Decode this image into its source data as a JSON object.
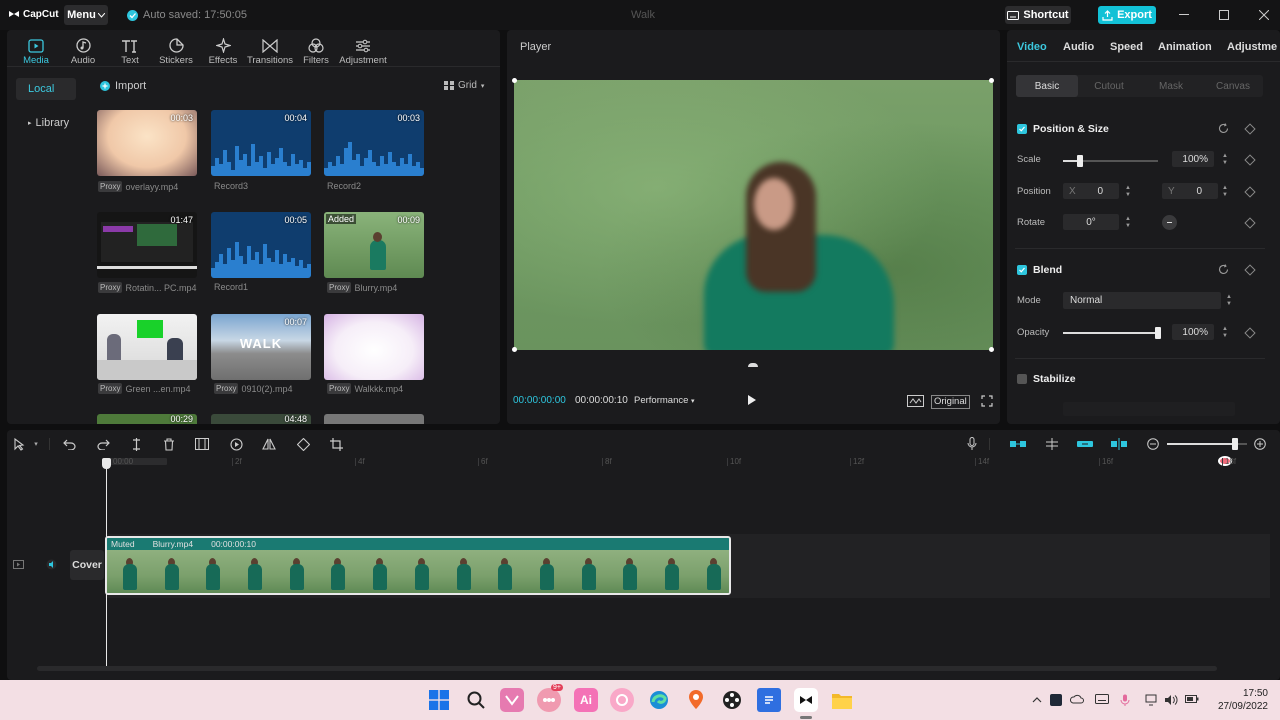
{
  "titlebar": {
    "logo": "CapCut",
    "menu": "Menu",
    "autosave": "Auto saved: 17:50:05",
    "title": "Walk",
    "shortcut": "Shortcut",
    "export": "Export"
  },
  "media_toolbar": [
    {
      "label": "Media",
      "icon": "media-icon",
      "active": true
    },
    {
      "label": "Audio",
      "icon": "audio-icon"
    },
    {
      "label": "Text",
      "icon": "text-icon"
    },
    {
      "label": "Stickers",
      "icon": "sticker-icon"
    },
    {
      "label": "Effects",
      "icon": "effects-icon"
    },
    {
      "label": "Transitions",
      "icon": "transitions-icon"
    },
    {
      "label": "Filters",
      "icon": "filters-icon"
    },
    {
      "label": "Adjustment",
      "icon": "adjustment-icon"
    }
  ],
  "media_side": {
    "local": "Local",
    "library": "Library"
  },
  "media_actions": {
    "import": "Import",
    "view": "Grid"
  },
  "media_items": [
    {
      "name": "overlayy.mp4",
      "duration": "00:03",
      "proxy": "Proxy"
    },
    {
      "name": "Record3",
      "duration": "00:04"
    },
    {
      "name": "Record2",
      "duration": "00:03"
    },
    {
      "name": "Rotatin... PC.mp4",
      "duration": "01:47",
      "proxy": "Proxy"
    },
    {
      "name": "Record1",
      "duration": "00:05"
    },
    {
      "name": "Blurry.mp4",
      "duration": "00:09",
      "proxy": "Proxy",
      "badge": "Added"
    },
    {
      "name": "Green ...en.mp4",
      "duration": "",
      "proxy": "Proxy"
    },
    {
      "name": "0910(2).mp4",
      "duration": "00:07",
      "proxy": "Proxy",
      "overlay_text": "WALK"
    },
    {
      "name": "Walkkk.mp4",
      "duration": "",
      "proxy": "Proxy"
    },
    {
      "name": "",
      "duration": "00:29"
    },
    {
      "name": "",
      "duration": "04:48"
    }
  ],
  "player": {
    "title": "Player",
    "current_time": "00:00:00:00",
    "total_time": "00:00:00:10",
    "performance": "Performance",
    "original": "Original"
  },
  "props": {
    "tabs": [
      "Video",
      "Audio",
      "Speed",
      "Animation",
      "Adjustme"
    ],
    "subtabs": [
      "Basic",
      "Cutout",
      "Mask",
      "Canvas"
    ],
    "position_size": "Position & Size",
    "scale_label": "Scale",
    "scale_value": "100%",
    "position_label": "Position",
    "x_label": "X",
    "x_value": "0",
    "y_label": "Y",
    "y_value": "0",
    "rotate_label": "Rotate",
    "rotate_value": "0°",
    "blend": "Blend",
    "mode_label": "Mode",
    "mode_value": "Normal",
    "opacity_label": "Opacity",
    "opacity_value": "100%",
    "stabilize": "Stabilize",
    "scale_fraction": 0.18,
    "opacity_fraction": 1.0
  },
  "timeline": {
    "ruler": [
      "00:00",
      "2f",
      "4f",
      "6f",
      "8f",
      "10f",
      "12f",
      "14f",
      "16f",
      "18f"
    ],
    "clip": {
      "muted": "Muted",
      "name": "Blurry.mp4",
      "duration": "00:00:00:10"
    },
    "cover": "Cover",
    "zoom_fraction": 0.85
  },
  "taskbar": {
    "time": "17:50",
    "date": "27/09/2022",
    "badge": "9+"
  },
  "colors": {
    "accent": "#2ec6de",
    "export": "#12c1d6",
    "clip": "#1e6e68"
  }
}
